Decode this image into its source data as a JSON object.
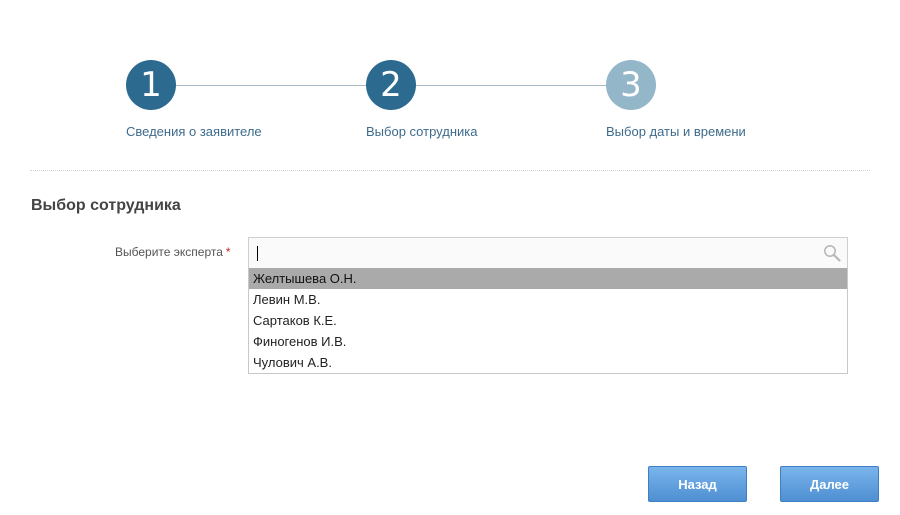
{
  "stepper": {
    "steps": [
      {
        "number": "1",
        "label": "Сведения о заявителе",
        "state": "completed"
      },
      {
        "number": "2",
        "label": "Выбор сотрудника",
        "state": "active"
      },
      {
        "number": "3",
        "label": "Выбор даты и времени",
        "state": "inactive"
      }
    ]
  },
  "section": {
    "title": "Выбор сотрудника"
  },
  "expert_field": {
    "label": "Выберите эксперта",
    "required_mark": "*",
    "value": "",
    "icon": "search-icon"
  },
  "dropdown": {
    "highlighted_index": 0,
    "options": [
      "Желтышева О.Н.",
      "Левин М.В.",
      "Сартаков К.Е.",
      "Финогенов И.В.",
      "Чулович А.В."
    ]
  },
  "buttons": {
    "back_label": "Назад",
    "next_label": "Далее"
  },
  "colors": {
    "step_active": "#2d6a90",
    "step_inactive": "#94b6c9",
    "button": "#5d9ddf",
    "highlight": "#aaaaaa"
  }
}
